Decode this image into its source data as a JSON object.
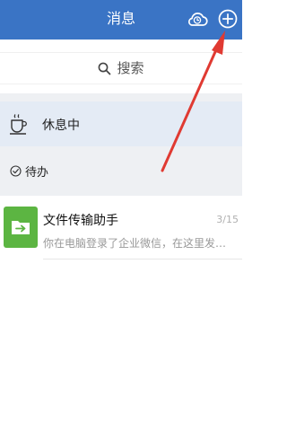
{
  "header": {
    "title": "消息",
    "cloud_icon": "cloud-clock-icon",
    "add_icon": "plus-circle-icon"
  },
  "search": {
    "label": "搜索",
    "icon": "search-icon"
  },
  "rest_status": {
    "label": "休息中",
    "icon": "coffee-cup-icon"
  },
  "todo": {
    "label": "待办",
    "icon": "check-circle-icon"
  },
  "chat": {
    "name": "文件传输助手",
    "preview": "你在电脑登录了企业微信，在这里发送文...",
    "time": "3/15",
    "icon": "file-transfer-icon"
  },
  "colors": {
    "header_bg": "#3a74c5",
    "rest_bg": "#e4ebf5",
    "avatar_bg": "#5cb542",
    "annotation_arrow": "#e03a32"
  }
}
